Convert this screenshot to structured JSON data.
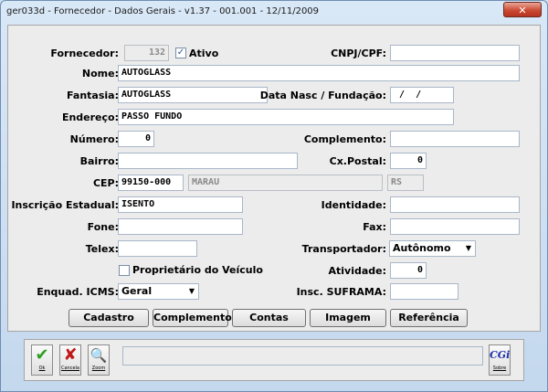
{
  "window": {
    "title": "ger033d - Fornecedor - Dados Gerais -  v1.37 - 001.001 - 12/11/2009",
    "close_icon": "✕"
  },
  "form": {
    "fornecedor": {
      "label": "Fornecedor:",
      "value": "132"
    },
    "ativo": {
      "label": "Ativo",
      "checked": true,
      "mark": "✓"
    },
    "cnpj": {
      "label": "CNPJ/CPF:",
      "value": ""
    },
    "nome": {
      "label": "Nome:",
      "value": "AUTOGLASS"
    },
    "fantasia": {
      "label": "Fantasia:",
      "value": "AUTOGLASS"
    },
    "data_nasc": {
      "label": "Data Nasc / Fundação:",
      "value": " /  /"
    },
    "endereco": {
      "label": "Endereço:",
      "value": "PASSO FUNDO"
    },
    "numero": {
      "label": "Número:",
      "value": "0"
    },
    "complemento": {
      "label": "Complemento:",
      "value": ""
    },
    "bairro": {
      "label": "Bairro:",
      "value": ""
    },
    "cx_postal": {
      "label": "Cx.Postal:",
      "value": "0"
    },
    "cep": {
      "label": "CEP:",
      "value": "99150-000",
      "cidade": "MARAU",
      "uf": "RS"
    },
    "inscricao_estadual": {
      "label": "Inscrição Estadual:",
      "value": "ISENTO"
    },
    "identidade": {
      "label": "Identidade:",
      "value": ""
    },
    "fone": {
      "label": "Fone:",
      "value": ""
    },
    "fax": {
      "label": "Fax:",
      "value": ""
    },
    "telex": {
      "label": "Telex:",
      "value": ""
    },
    "transportador": {
      "label": "Transportador:",
      "value": "Autônomo"
    },
    "proprietario": {
      "label": "Proprietário do Veículo",
      "checked": false
    },
    "atividade": {
      "label": "Atividade:",
      "value": "0"
    },
    "enquad_icms": {
      "label": "Enquad. ICMS:",
      "value": "Geral"
    },
    "suframa": {
      "label": "Insc. SUFRAMA:",
      "value": ""
    }
  },
  "buttons": {
    "cadastro": "Cadastro",
    "complemento": "Complemento",
    "contas": "Contas",
    "imagem": "Imagem",
    "referencia": "Referência"
  },
  "toolbar": {
    "ok": {
      "icon": "✔",
      "label": "Ok"
    },
    "cancela": {
      "icon": "✘",
      "label": "Cancela"
    },
    "zoom": {
      "icon": "🔍",
      "label": "Zoom"
    },
    "sobre": {
      "icon": "CGi",
      "label": "Sobre"
    }
  },
  "colors": {
    "ok_green": "#2e9e20",
    "cancel_red": "#c01818",
    "zoom_yellow": "#d8a800",
    "cgi_blue": "#1a2fa8"
  }
}
